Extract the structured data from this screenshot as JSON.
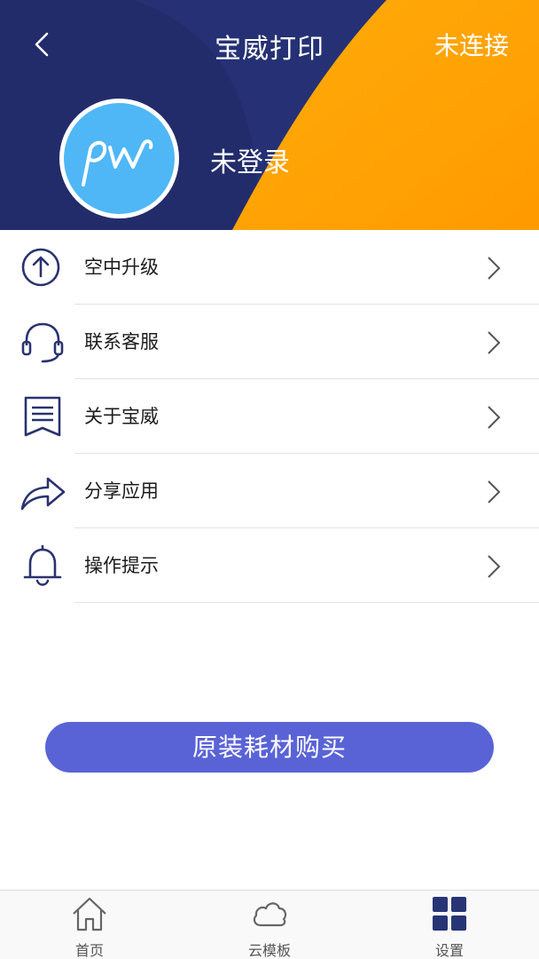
{
  "header": {
    "title": "宝威打印",
    "connection_status": "未连接",
    "login_status": "未登录",
    "avatar_logo_text": "pw",
    "colors": {
      "navy": "#253174",
      "orange": "#ffa200"
    }
  },
  "menu": {
    "items": [
      {
        "label": "空中升级",
        "icon": "arrow-up-circle-icon"
      },
      {
        "label": "联系客服",
        "icon": "headset-icon"
      },
      {
        "label": "关于宝威",
        "icon": "document-icon"
      },
      {
        "label": "分享应用",
        "icon": "share-arrow-icon"
      },
      {
        "label": "操作提示",
        "icon": "bell-icon"
      }
    ]
  },
  "buy_button": {
    "label": "原装耗材购买",
    "color": "#5a63d6"
  },
  "tabbar": {
    "tabs": [
      {
        "label": "首页",
        "icon": "home-icon"
      },
      {
        "label": "云模板",
        "icon": "cloud-icon"
      },
      {
        "label": "设置",
        "icon": "grid-icon",
        "active": true
      }
    ]
  }
}
